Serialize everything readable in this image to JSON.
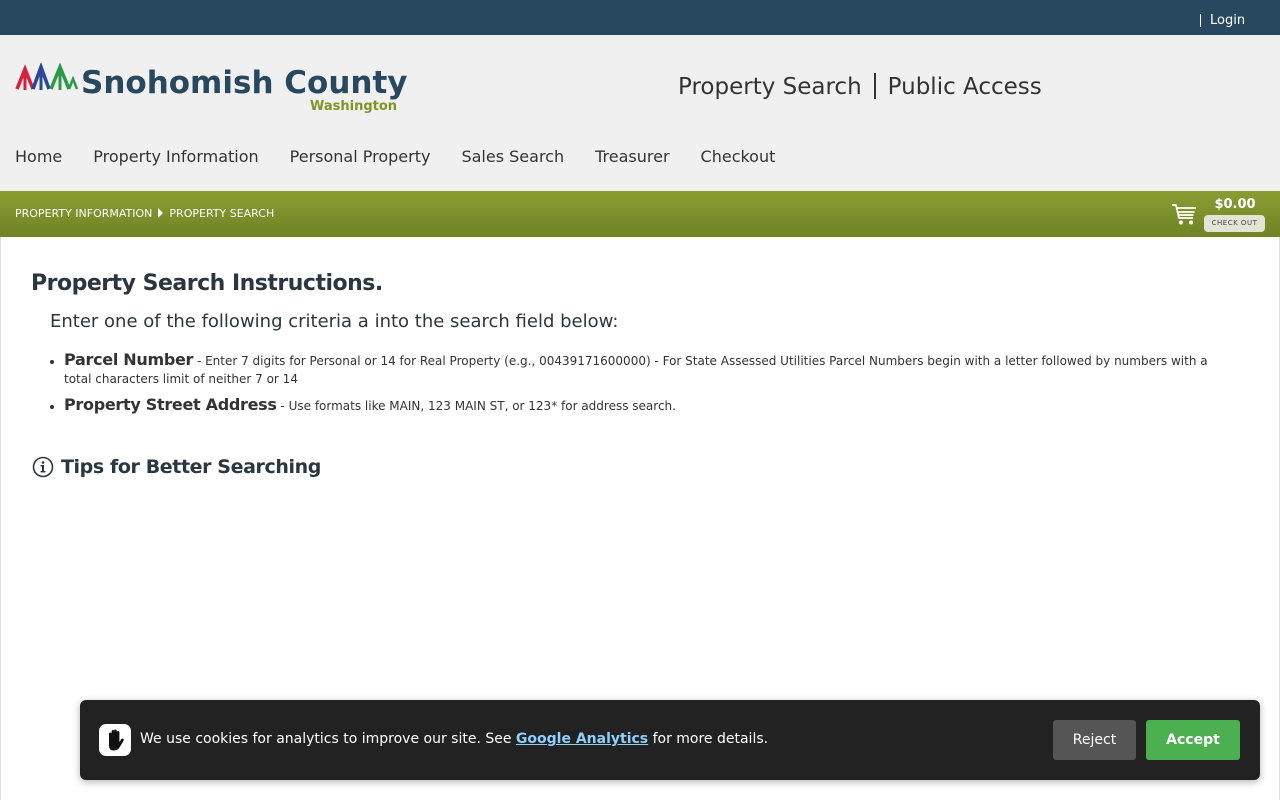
{
  "topbar": {
    "login_label": "Login"
  },
  "logo": {
    "county": "Snohomish County",
    "state": "Washington"
  },
  "header": {
    "title_left": "Property Search",
    "title_right": "Public Access"
  },
  "nav": {
    "items": [
      {
        "label": "Home"
      },
      {
        "label": "Property Information"
      },
      {
        "label": "Personal Property"
      },
      {
        "label": "Sales Search"
      },
      {
        "label": "Treasurer"
      },
      {
        "label": "Checkout"
      }
    ]
  },
  "breadcrumb": {
    "items": [
      "PROPERTY INFORMATION",
      "PROPERTY SEARCH"
    ]
  },
  "cart": {
    "total": "$0.00",
    "checkout_label": "CHECK OUT",
    "icon": "cart-icon"
  },
  "instructions": {
    "title": "Property Search Instructions.",
    "intro": "Enter one of the following criteria a into the search field below:",
    "criteria": [
      {
        "term": "Parcel Number",
        "desc": " - Enter 7 digits for Personal or 14 for Real Property (e.g., 00439171600000) - For State Assessed Utilities Parcel Numbers begin with a letter followed by numbers with a total characters limit of neither 7 or 14"
      },
      {
        "term": "Property Street Address",
        "desc": " - Use formats like MAIN, 123 MAIN ST, or 123* for address search."
      }
    ],
    "tips_label": "Tips for Better Searching",
    "tips_icon": "info-icon"
  },
  "cookie_banner": {
    "message_before": "We use cookies for analytics to improve our site. See ",
    "link_label": "Google Analytics",
    "message_after": " for more details.",
    "reject_label": "Reject",
    "accept_label": "Accept",
    "icon": "hand-icon"
  },
  "colors": {
    "topbar": "#284860",
    "header_bg": "#f0f0f0",
    "crumb_bar": "#7f9428",
    "accept": "#4caf50",
    "reject": "#555555",
    "banner": "#222222"
  }
}
